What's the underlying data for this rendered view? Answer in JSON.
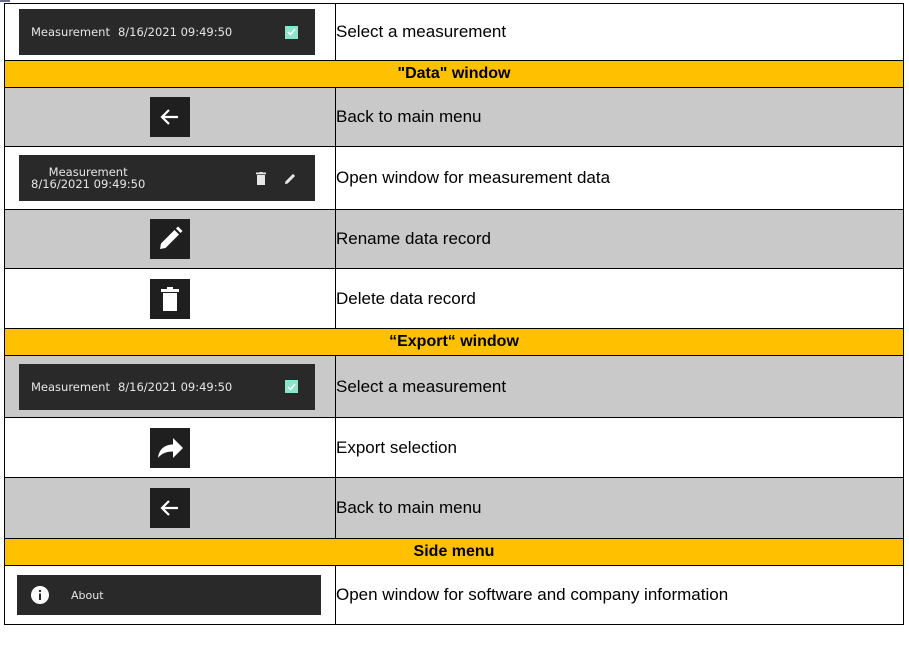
{
  "rows": {
    "select_1": {
      "widget": {
        "label": "Measurement",
        "datetime": "8/16/2021 09:49:50",
        "checkbox_icon": "checkbox-checked-icon"
      },
      "description": "Select a measurement"
    },
    "section_data": {
      "title": "\"Data\" window"
    },
    "back_1": {
      "icon": "arrow-left-icon",
      "description": "Back to main menu"
    },
    "open_data": {
      "widget": {
        "label": "Measurement",
        "datetime": "8/16/2021 09:49:50",
        "icons": [
          "trash-icon",
          "pencil-icon"
        ]
      },
      "description": "Open window for measurement data"
    },
    "rename": {
      "icon": "pencil-icon",
      "description": "Rename data record"
    },
    "delete": {
      "icon": "trash-icon",
      "description": "Delete data record"
    },
    "section_export": {
      "title": "“Export“ window"
    },
    "select_2": {
      "widget": {
        "label": "Measurement",
        "datetime": "8/16/2021 09:49:50",
        "checkbox_icon": "checkbox-checked-icon"
      },
      "description": "Select a measurement"
    },
    "export": {
      "icon": "share-arrow-icon",
      "description": "Export selection"
    },
    "back_2": {
      "icon": "arrow-left-icon",
      "description": "Back to main menu"
    },
    "section_side": {
      "title": "Side menu"
    },
    "about": {
      "widget": {
        "icon": "info-icon",
        "label": "About"
      },
      "description": "Open window for software and company information"
    }
  },
  "colors": {
    "section": "#ffc000",
    "gray_row": "#c9c9c9",
    "dark_widget": "#292929",
    "checkbox": "#8ee3c8"
  }
}
